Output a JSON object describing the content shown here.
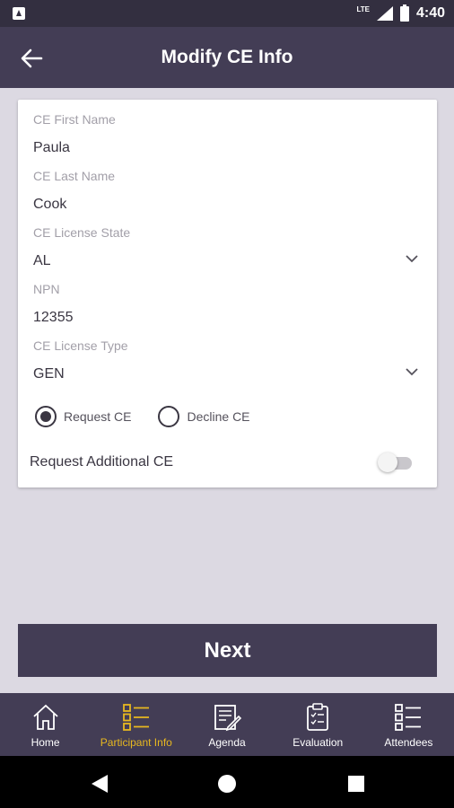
{
  "status_bar": {
    "network": "LTE",
    "time": "4:40"
  },
  "header": {
    "title": "Modify CE Info"
  },
  "form": {
    "first_name": {
      "label": "CE First Name",
      "value": "Paula"
    },
    "last_name": {
      "label": "CE Last Name",
      "value": "Cook"
    },
    "license_state": {
      "label": "CE License State",
      "value": "AL"
    },
    "npn": {
      "label": "NPN",
      "value": "12355"
    },
    "license_type": {
      "label": "CE License Type",
      "value": "GEN"
    },
    "ce_choice": {
      "options": [
        {
          "label": "Request CE",
          "selected": true
        },
        {
          "label": "Decline CE",
          "selected": false
        }
      ]
    },
    "additional_ce": {
      "label": "Request Additional CE",
      "on": false
    }
  },
  "next_button": {
    "label": "Next"
  },
  "bottom_nav": {
    "items": [
      {
        "label": "Home",
        "icon": "home-icon",
        "active": false
      },
      {
        "label": "Participant Info",
        "icon": "list-icon",
        "active": true
      },
      {
        "label": "Agenda",
        "icon": "agenda-icon",
        "active": false
      },
      {
        "label": "Evaluation",
        "icon": "clipboard-icon",
        "active": false
      },
      {
        "label": "Attendees",
        "icon": "checklist-icon",
        "active": false
      }
    ]
  },
  "colors": {
    "primary": "#433d55",
    "status_bar": "#332f40",
    "accent": "#e8b820",
    "background": "#dcd9e2"
  }
}
